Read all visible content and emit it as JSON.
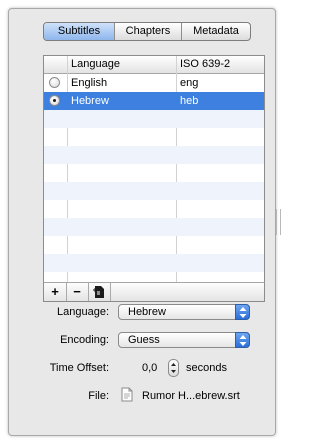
{
  "tabs": [
    {
      "label": "Subtitles",
      "selected": true
    },
    {
      "label": "Chapters",
      "selected": false
    },
    {
      "label": "Metadata",
      "selected": false
    }
  ],
  "table": {
    "columns": [
      "",
      "Language",
      "ISO 639-2"
    ],
    "rows": [
      {
        "active": false,
        "language": "English",
        "iso": "eng"
      },
      {
        "active": true,
        "language": "Hebrew",
        "iso": "heb"
      }
    ],
    "selected_row": 1,
    "footer_buttons": [
      {
        "label": "+",
        "icon": "add-icon"
      },
      {
        "label": "−",
        "icon": "remove-icon"
      },
      {
        "label": "",
        "icon": "document-import-icon"
      }
    ]
  },
  "form": {
    "language_label": "Language:",
    "language_value": "Hebrew",
    "encoding_label": "Encoding:",
    "encoding_value": "Guess",
    "time_offset_label": "Time Offset:",
    "time_offset_value": "0,0",
    "time_offset_unit": "seconds",
    "file_label": "File:",
    "file_icon": "document-icon",
    "file_name": "Rumor H...ebrew.srt"
  },
  "colors": {
    "selection": "#3d80df",
    "stripe": "#eef3fc",
    "tab_selected": "#a9c8f2",
    "popup_arrows": "#2a6ed8"
  }
}
